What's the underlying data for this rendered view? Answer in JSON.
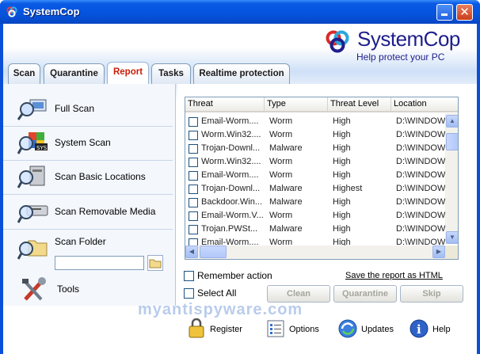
{
  "window": {
    "title": "SystemCop",
    "colors": {
      "titlebar": "#0553dd",
      "active_tab_text": "#c81e0a",
      "brand_text": "#1e1e8c"
    }
  },
  "brand": {
    "name": "SystemCop",
    "tagline": "Help protect your PC"
  },
  "tabs": [
    {
      "label": "Scan",
      "active": false
    },
    {
      "label": "Quarantine",
      "active": false
    },
    {
      "label": "Report",
      "active": true
    },
    {
      "label": "Tasks",
      "active": false
    },
    {
      "label": "Realtime protection",
      "active": false
    }
  ],
  "sidebar": {
    "items": [
      {
        "label": "Full Scan",
        "icon": "magnifier-computer-icon"
      },
      {
        "label": "System Scan",
        "icon": "magnifier-sys-icon"
      },
      {
        "label": "Scan Basic Locations",
        "icon": "magnifier-drive-icon"
      },
      {
        "label": "Scan Removable Media",
        "icon": "magnifier-removable-drive-icon"
      },
      {
        "label": "Scan Folder",
        "icon": "magnifier-folder-icon"
      },
      {
        "label": "Tools",
        "icon": "tools-icon"
      }
    ],
    "folder_input_value": ""
  },
  "report": {
    "columns": [
      "Threat",
      "Type",
      "Threat Level",
      "Location"
    ],
    "rows": [
      [
        "Email-Worm....",
        "Worm",
        "High",
        "D:\\WINDOW"
      ],
      [
        "Worm.Win32....",
        "Worm",
        "High",
        "D:\\WINDOW"
      ],
      [
        "Trojan-Downl...",
        "Malware",
        "High",
        "D:\\WINDOW"
      ],
      [
        "Worm.Win32....",
        "Worm",
        "High",
        "D:\\WINDOW"
      ],
      [
        "Email-Worm....",
        "Worm",
        "High",
        "D:\\WINDOW"
      ],
      [
        "Trojan-Downl...",
        "Malware",
        "Highest",
        "D:\\WINDOW"
      ],
      [
        "Backdoor.Win...",
        "Malware",
        "High",
        "D:\\WINDOW"
      ],
      [
        "Email-Worm.V...",
        "Worm",
        "High",
        "D:\\WINDOW"
      ],
      [
        "Trojan.PWSt...",
        "Malware",
        "High",
        "D:\\WINDOW"
      ],
      [
        "Email-Worm....",
        "Worm",
        "High",
        "D:\\WINDOW"
      ]
    ],
    "remember_action": "Remember action",
    "select_all": "Select All",
    "save_link": "Save the report as HTML",
    "buttons": {
      "clean": "Clean",
      "quarantine": "Quarantine",
      "skip": "Skip"
    }
  },
  "watermark": "myantispyware.com",
  "bottom": [
    {
      "label": "Register",
      "icon": "register-icon"
    },
    {
      "label": "Options",
      "icon": "options-icon"
    },
    {
      "label": "Updates",
      "icon": "updates-icon"
    },
    {
      "label": "Help",
      "icon": "help-icon"
    }
  ]
}
